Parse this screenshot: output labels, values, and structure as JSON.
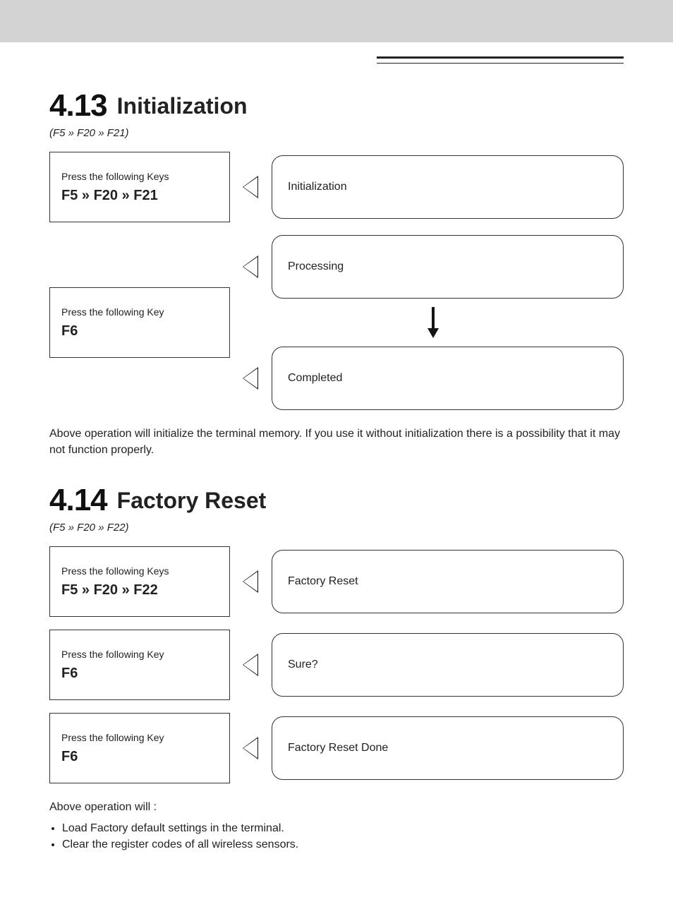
{
  "s1": {
    "num": "4.13",
    "name": "Initialization",
    "sub": "(F5 » F20 » F21)",
    "step1": {
      "key_intro": "Press the following Keys",
      "nav": "F5 » F20 » F21",
      "bubble": "Initialization"
    },
    "step2": {
      "key_intro": "Press the following Key",
      "nav": "F6",
      "bubble1": "Processing",
      "bubble2": "Completed"
    },
    "note": "Above operation will initialize the terminal memory. If you use it without initialization there is a possibility that it may not function properly."
  },
  "s2": {
    "num": "4.14",
    "name": "Factory Reset",
    "sub": "(F5 » F20 » F22)",
    "step1": {
      "key_intro": "Press the following Keys",
      "nav": "F5 » F20 » F22",
      "bubble": "Factory Reset"
    },
    "step2": {
      "key_intro": "Press the following Key",
      "nav": "F6",
      "bubble": "Sure?"
    },
    "step3": {
      "key_intro": "Press the following Key",
      "nav": "F6",
      "bubble": "Factory Reset Done"
    },
    "note_lead": "Above operation will :",
    "note_items": [
      "Load Factory default settings in the terminal.",
      "Clear the register codes of all wireless sensors."
    ]
  }
}
